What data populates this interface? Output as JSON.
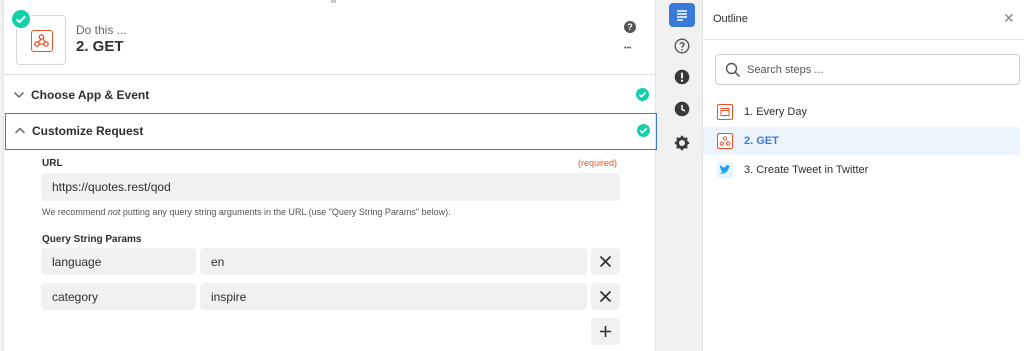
{
  "step": {
    "subtitle": "Do this ...",
    "title": "2. GET",
    "help_glyph": "?",
    "more_glyph": "•••"
  },
  "sections": {
    "choose": "Choose App & Event",
    "customize": "Customize Request"
  },
  "url": {
    "label": "URL",
    "required": "(required)",
    "value": "https://quotes.rest/qod",
    "hint_before": "We recommend ",
    "hint_em": "not",
    "hint_after": " putting any query string arguments in the URL (use \"Query String Params\" below)."
  },
  "params": {
    "label": "Query String Params",
    "rows": [
      {
        "key": "language",
        "value": "en"
      },
      {
        "key": "category",
        "value": "inspire"
      }
    ],
    "remove_glyph": "✕",
    "add_glyph": "+"
  },
  "outline": {
    "title": "Outline",
    "close_glyph": "✕",
    "search_placeholder": "Search steps ...",
    "items": [
      {
        "label": "1. Every Day",
        "icon": "schedule-icon"
      },
      {
        "label": "2. GET",
        "icon": "webhook-icon"
      },
      {
        "label": "3. Create Tweet in Twitter",
        "icon": "twitter-icon"
      }
    ]
  },
  "colors": {
    "accent": "#3b7ad9",
    "success": "#13d0ab",
    "brand_orange": "#e8542a",
    "twitter": "#1da1f2"
  }
}
